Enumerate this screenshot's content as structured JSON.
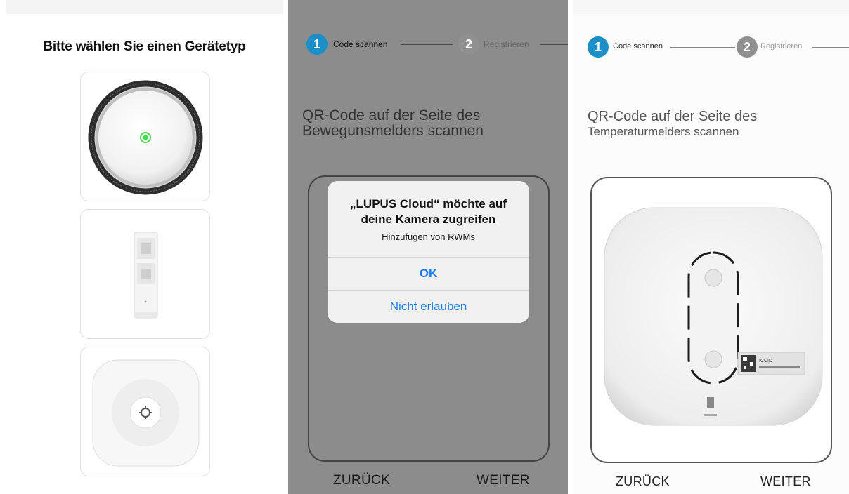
{
  "colors": {
    "step_active": "#1c8fc9",
    "step_inactive": "#909090",
    "alert_button": "#1b7cf5",
    "led_green": "#3fd84a",
    "dim_overlay": "#8c8c8c"
  },
  "device_type_screen": {
    "title": "Bitte wählen Sie einen Gerätetyp",
    "devices": [
      {
        "icon": "smoke-detector-icon"
      },
      {
        "icon": "motion-detector-icon"
      },
      {
        "icon": "temperature-sensor-icon"
      }
    ]
  },
  "steps": [
    {
      "number": "1",
      "label": "Code scannen"
    },
    {
      "number": "2",
      "label": "Registrieren"
    }
  ],
  "motion_scan_screen": {
    "instruction_line1": "QR-Code auf der Seite des",
    "instruction_line2": "Bewegunsmelders scannen",
    "back": "ZURÜCK",
    "next": "WEITER",
    "alert": {
      "title_line1": "„LUPUS Cloud“ möchte auf",
      "title_line2": "deine Kamera zugreifen",
      "message": "Hinzufügen von RWMs",
      "ok": "OK",
      "deny": "Nicht erlauben"
    }
  },
  "temperature_scan_screen": {
    "instruction_line1": "QR-Code auf der Seite des",
    "instruction_line2": "Temperaturmelders scannen",
    "label_text": "ICCID",
    "back": "ZURÜCK",
    "next": "WEITER"
  }
}
